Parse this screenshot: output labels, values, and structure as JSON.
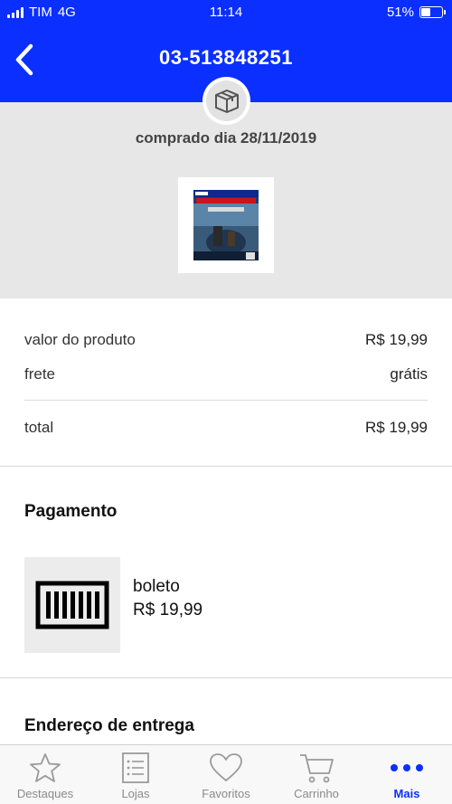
{
  "status_bar": {
    "carrier": "TIM",
    "network": "4G",
    "time": "11:14",
    "battery": "51%",
    "battery_level": 0.51
  },
  "header": {
    "title": "03-513848251",
    "back_icon": "chevron-left-icon"
  },
  "order": {
    "purchased_label": "comprado dia 28/11/2019",
    "product_icon": "box-icon"
  },
  "summary": {
    "product_value_label": "valor do produto",
    "product_value": "R$ 19,99",
    "shipping_label": "frete",
    "shipping_value": "grátis",
    "total_label": "total",
    "total_value": "R$ 19,99"
  },
  "payment": {
    "title": "Pagamento",
    "method": "boleto",
    "amount": "R$ 19,99",
    "icon": "barcode-icon"
  },
  "address": {
    "title": "Endereço de entrega"
  },
  "tabs": [
    {
      "label": "Destaques",
      "icon": "star-icon"
    },
    {
      "label": "Lojas",
      "icon": "list-icon"
    },
    {
      "label": "Favoritos",
      "icon": "heart-icon"
    },
    {
      "label": "Carrinho",
      "icon": "cart-icon"
    },
    {
      "label": "Mais",
      "icon": "more-icon",
      "active": true
    }
  ],
  "colors": {
    "brand_blue": "#0a2fff",
    "hero_bg": "#e7e7e7",
    "tab_inactive": "#8a8a8a"
  }
}
